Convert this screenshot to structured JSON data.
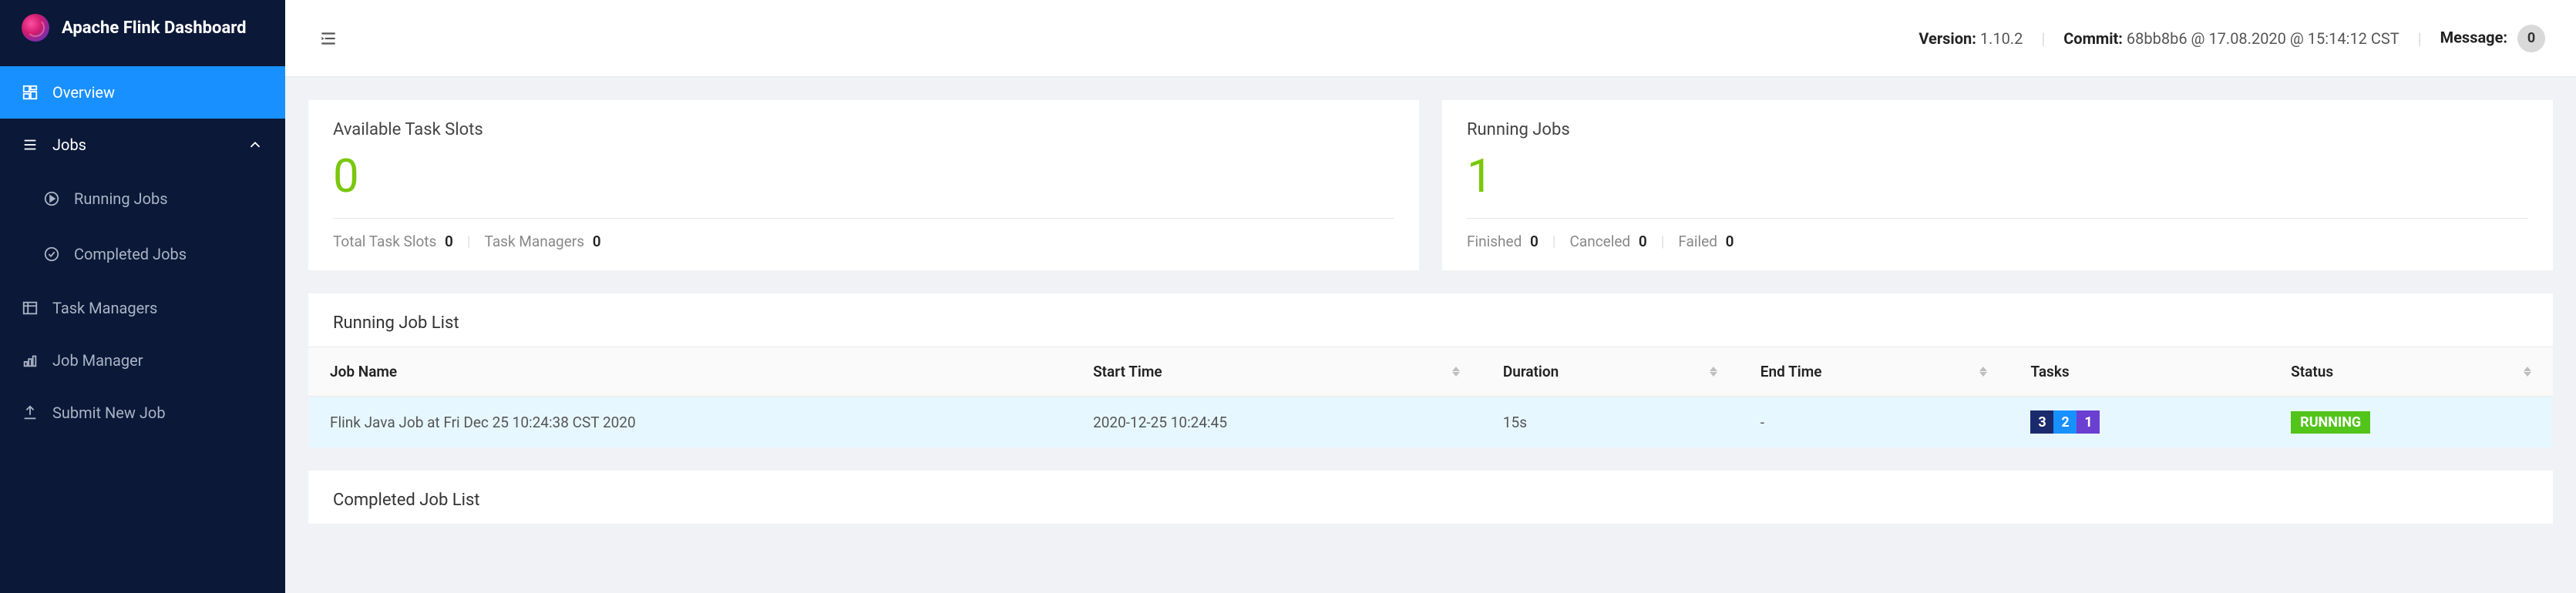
{
  "brand": {
    "title": "Apache Flink Dashboard"
  },
  "sidebar": {
    "items": [
      {
        "label": "Overview"
      },
      {
        "label": "Jobs"
      },
      {
        "label": "Running Jobs"
      },
      {
        "label": "Completed Jobs"
      },
      {
        "label": "Task Managers"
      },
      {
        "label": "Job Manager"
      },
      {
        "label": "Submit New Job"
      }
    ]
  },
  "topbar": {
    "version_label": "Version:",
    "version_value": "1.10.2",
    "commit_label": "Commit:",
    "commit_value": "68bb8b6 @ 17.08.2020 @ 15:14:12 CST",
    "message_label": "Message:",
    "message_count": "0"
  },
  "cards": {
    "slots": {
      "title": "Available Task Slots",
      "value": "0",
      "total_label": "Total Task Slots",
      "total_value": "0",
      "tm_label": "Task Managers",
      "tm_value": "0"
    },
    "running": {
      "title": "Running Jobs",
      "value": "1",
      "finished_label": "Finished",
      "finished_value": "0",
      "canceled_label": "Canceled",
      "canceled_value": "0",
      "failed_label": "Failed",
      "failed_value": "0"
    }
  },
  "running_list": {
    "title": "Running Job List",
    "columns": {
      "name": "Job Name",
      "start": "Start Time",
      "duration": "Duration",
      "end": "End Time",
      "tasks": "Tasks",
      "status": "Status"
    },
    "row": {
      "name": "Flink Java Job at Fri Dec 25 10:24:38 CST 2020",
      "start": "2020-12-25 10:24:45",
      "duration": "15s",
      "end": "-",
      "tasks": {
        "a": "3",
        "b": "2",
        "c": "1"
      },
      "status": "RUNNING"
    }
  },
  "completed_list": {
    "title": "Completed Job List"
  }
}
